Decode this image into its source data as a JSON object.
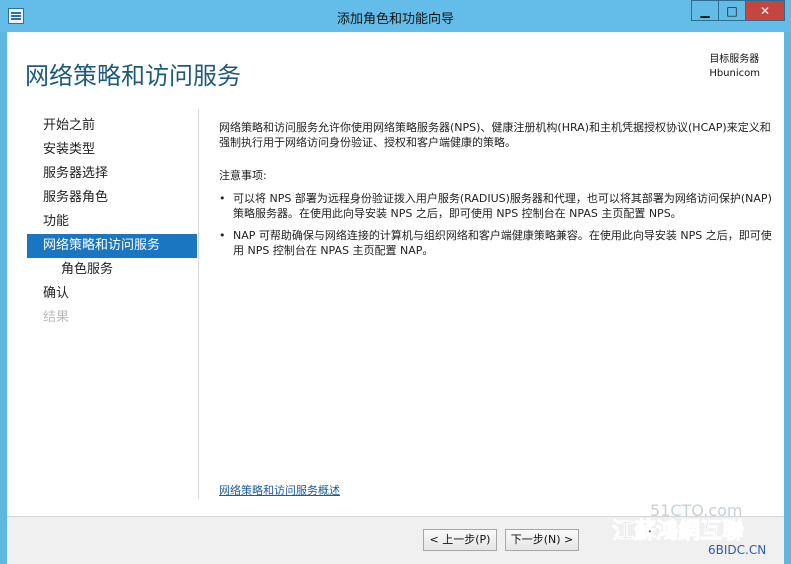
{
  "window": {
    "title": "添加角色和功能向导"
  },
  "header": {
    "title": "网络策略和访问服务",
    "target_label": "目标服务器",
    "target_server": "Hbunicom"
  },
  "nav": {
    "items": [
      {
        "label": "开始之前"
      },
      {
        "label": "安装类型"
      },
      {
        "label": "服务器选择"
      },
      {
        "label": "服务器角色"
      },
      {
        "label": "功能"
      },
      {
        "label": "网络策略和访问服务"
      },
      {
        "label": "角色服务"
      },
      {
        "label": "确认"
      },
      {
        "label": "结果"
      }
    ]
  },
  "main": {
    "intro": "网络策略和访问服务允许你使用网络策略服务器(NPS)、健康注册机构(HRA)和主机凭据授权协议(HCAP)来定义和强制执行用于网络访问身份验证、授权和客户端健康的策略。",
    "notes_title": "注意事项:",
    "bullets": [
      "可以将 NPS 部署为远程身份验证拨入用户服务(RADIUS)服务器和代理，也可以将其部署为网络访问保护(NAP)策略服务器。在使用此向导安装 NPS 之后，即可使用 NPS 控制台在 NPAS 主页配置 NPS。",
      "NAP 可帮助确保与网络连接的计算机与组织网络和客户端健康策略兼容。在使用此向导安装 NPS 之后，即可使用 NPS 控制台在 NPAS 主页配置 NAP。"
    ],
    "link": "网络策略和访问服务概述"
  },
  "footer": {
    "prev_label": "< 上一步(P)",
    "next_label": "下一步(N) >"
  },
  "watermark": {
    "line1": "51CTO.com",
    "line2": "江蘇鴻網互聯",
    "line3": "6BIDC.CN"
  }
}
